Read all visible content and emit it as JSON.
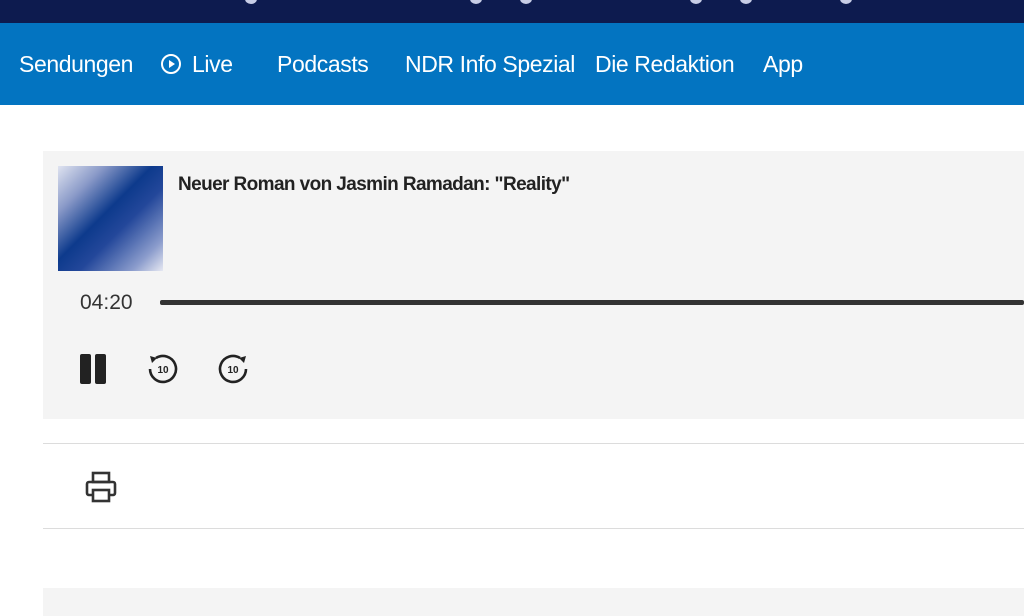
{
  "nav": {
    "items": [
      {
        "label": "Sendungen",
        "icon": null
      },
      {
        "label": "Live",
        "icon": "play-circle-icon"
      },
      {
        "label": "Podcasts",
        "icon": null
      },
      {
        "label": "NDR Info Spezial",
        "icon": null
      },
      {
        "label": "Die Redaktion",
        "icon": null
      },
      {
        "label": "App",
        "icon": null
      }
    ]
  },
  "player": {
    "title": "Neuer Roman von Jasmin Ramadan: \"Reality\"",
    "time": "04:20",
    "progress": 1.0,
    "controls": {
      "pause_icon": "pause-icon",
      "rewind_icon": "rewind-10-icon",
      "forward_icon": "forward-10-icon",
      "rewind_label": "10",
      "forward_label": "10"
    }
  },
  "tools": {
    "print_icon": "print-icon"
  },
  "colors": {
    "topbar": "#0d1b4f",
    "nav": "#0374c1",
    "player_bg": "#f4f4f4"
  }
}
